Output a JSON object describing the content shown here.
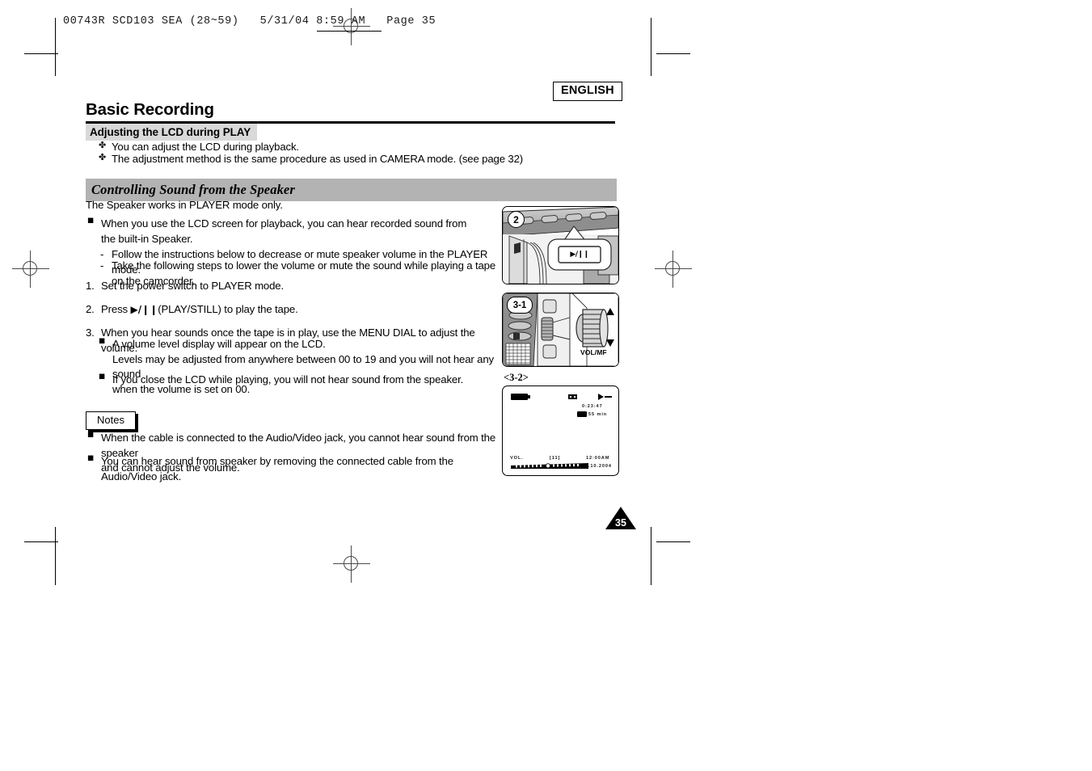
{
  "print_slug": "00743R SCD103 SEA (28~59)   5/31/04 8:59 AM   Page 35",
  "language_badge": "ENGLISH",
  "chapter_title": "Basic Recording",
  "subsection_lcd": {
    "heading": "Adjusting the LCD during PLAY",
    "bullets": [
      "You can adjust the LCD during playback.",
      "The adjustment method is the same procedure as used in CAMERA mode. (see page 32)"
    ],
    "bullet_glyph": "✤"
  },
  "subsection_speaker": {
    "heading": "Controlling Sound from the Speaker",
    "intro": "The Speaker works in PLAYER mode only.",
    "square_glyph": "■",
    "lead_bullet": {
      "line1": "When you use the LCD screen for playback, you can hear recorded sound from",
      "line2": "the built-in Speaker.",
      "sub_items": [
        "Follow the instructions below to decrease or mute speaker volume in the PLAYER mode.",
        "Take the following steps to lower the volume or mute the sound while playing a tape",
        "on the camcorder."
      ],
      "dash_glyph": "-"
    },
    "steps": [
      {
        "number": "1.",
        "text": "Set the power switch to PLAYER mode."
      },
      {
        "number": "2.",
        "text_before": "Press ",
        "icon": "▶/❙❙",
        "text_after": "(PLAY/STILL) to play the tape."
      },
      {
        "number": "3.",
        "text": "When you hear sounds once the tape is in play, use the MENU DIAL to adjust the volume.",
        "sub_bullets": [
          "A volume level display will appear on the LCD.",
          "If you close the LCD while playing, you will not hear sound from the speaker."
        ],
        "continuation": [
          "Levels may be adjusted from anywhere between 00 to 19 and you will not hear any sound",
          "when the volume is set on 00."
        ]
      }
    ]
  },
  "notes": {
    "label": "Notes",
    "square_glyph": "■",
    "items": [
      {
        "line1": "When the cable is connected to the Audio/Video jack, you cannot hear sound from the speaker",
        "line2": "and cannot adjust the volume."
      },
      {
        "line1": "You can hear sound from speaker by removing the connected cable from the Audio/Video jack.",
        "line2": ""
      }
    ]
  },
  "figures": {
    "fig_play": {
      "badge": "2",
      "button_icon": "▶/❙❙"
    },
    "fig_dial": {
      "badge": "3-1",
      "dial_label": "VOL/MF",
      "up_arrow": "▲",
      "down_arrow": "▼"
    },
    "fig_lcd": {
      "caption": "<3-2>",
      "timecode": "0:23:47",
      "tape_remaining": "55 min",
      "vol_label": "VOL.",
      "vol_level": "[11]",
      "clock": "12:00AM",
      "date": "JAN.10.2004"
    }
  },
  "page_number": "35"
}
